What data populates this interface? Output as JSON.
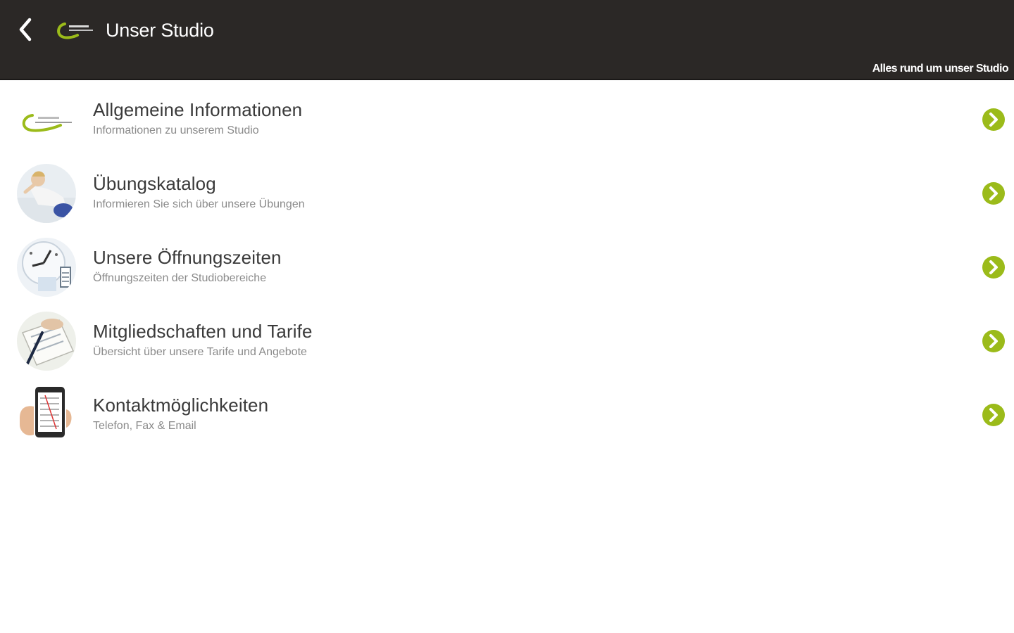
{
  "header": {
    "title": "Unser Studio",
    "subtitle": "Alles rund um unser Studio",
    "back_icon": "chevron-left-icon",
    "logo_icon": "studio-logo-icon",
    "background": "#2b2826"
  },
  "accent_color": "#9bbb1a",
  "items": [
    {
      "title": "Allgemeine Informationen",
      "subtitle": "Informationen zu unserem Studio",
      "icon": "studio-logo-icon"
    },
    {
      "title": "Übungskatalog",
      "subtitle": "Informieren Sie sich über unsere Übungen",
      "icon": "exercise-photo-icon"
    },
    {
      "title": "Unsere Öffnungszeiten",
      "subtitle": "Öffnungszeiten der Studiobereiche",
      "icon": "clock-photo-icon"
    },
    {
      "title": "Mitgliedschaften und Tarife",
      "subtitle": "Übersicht über unsere Tarife und Angebote",
      "icon": "contract-photo-icon"
    },
    {
      "title": "Kontaktmöglichkeiten",
      "subtitle": "Telefon, Fax & Email",
      "icon": "phone-photo-icon"
    }
  ]
}
